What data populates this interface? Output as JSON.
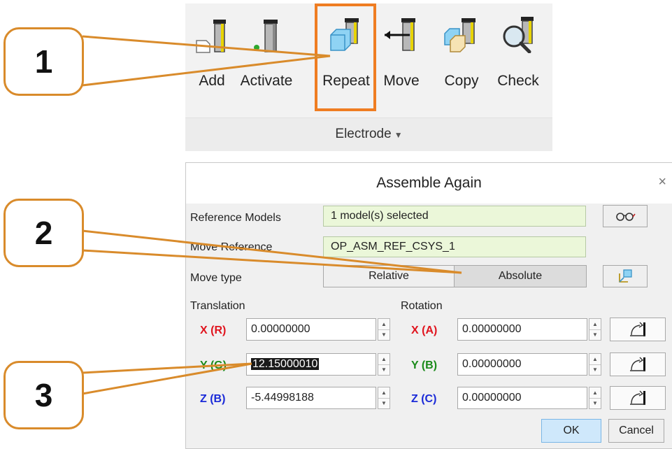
{
  "ribbon": {
    "buttons": [
      {
        "label": "Add",
        "icon": "electrode-add-icon"
      },
      {
        "label": "Activate",
        "icon": "electrode-activate-icon"
      },
      {
        "label": "Repeat",
        "icon": "electrode-repeat-icon"
      },
      {
        "label": "Move",
        "icon": "electrode-move-icon"
      },
      {
        "label": "Copy",
        "icon": "electrode-copy-icon"
      },
      {
        "label": "Check",
        "icon": "electrode-check-icon"
      }
    ],
    "group_label": "Electrode",
    "group_caret": "▼"
  },
  "callouts": [
    "1",
    "2",
    "3"
  ],
  "colors": {
    "accent": "#ef7d22",
    "callout_border": "#d98b2b",
    "field_green": "#ebf7d9",
    "ok_blue": "#cfe8fb"
  },
  "dialog": {
    "title": "Assemble Again",
    "close": "×",
    "reference_models_label": "Reference Models",
    "reference_models_value": "1 model(s) selected",
    "move_reference_label": "Move Reference",
    "move_reference_value": "OP_ASM_REF_CSYS_1",
    "move_type_label": "Move type",
    "move_type_options": [
      "Relative",
      "Absolute"
    ],
    "move_type_selected": "Absolute",
    "translation_label": "Translation",
    "rotation_label": "Rotation",
    "translation": [
      {
        "axis": "X (R)",
        "value": "0.00000000",
        "color": "#e0141e"
      },
      {
        "axis": "Y (G)",
        "value": "12.15000010",
        "color": "#1a8a1a"
      },
      {
        "axis": "Z (B)",
        "value": "-5.44998188",
        "color": "#1a2ad8"
      }
    ],
    "rotation": [
      {
        "axis": "X (A)",
        "value": "0.00000000",
        "color": "#e0141e"
      },
      {
        "axis": "Y (B)",
        "value": "0.00000000",
        "color": "#1a8a1a"
      },
      {
        "axis": "Z (C)",
        "value": "0.00000000",
        "color": "#1a2ad8"
      }
    ],
    "ok_label": "OK",
    "cancel_label": "Cancel"
  }
}
